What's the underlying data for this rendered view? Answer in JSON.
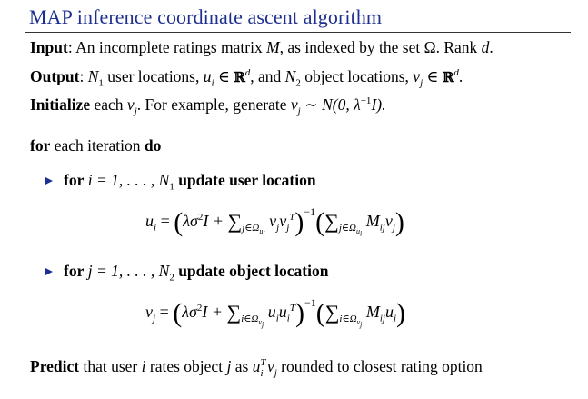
{
  "title": "MAP inference coordinate ascent algorithm",
  "input": {
    "label": "Input",
    "text_before": ": An incomplete ratings matrix ",
    "var_M": "M",
    "text_middle": ", as indexed by the set Ω. Rank ",
    "var_d": "d",
    "text_end": "."
  },
  "output": {
    "label": "Output",
    "text_1": ": ",
    "n1": "N",
    "n1_sub": "1",
    "text_2": " user locations, ",
    "u_expr": "u",
    "u_sub": "i",
    "in_R": " ∈ ",
    "R": "ℝ",
    "d_sup": "d",
    "text_3": ", and ",
    "n2": "N",
    "n2_sub": "2",
    "text_4": " object locations, ",
    "v_expr": "v",
    "v_sub": "j",
    "text_5": "."
  },
  "init": {
    "label": "Initialize",
    "text_1": " each ",
    "v": "v",
    "v_sub": "j",
    "text_2": ". For example, generate ",
    "dist": "v",
    "dist_sub": "j",
    "dist_rest": " ∼ N(0, λ",
    "lambda_sup": "−1",
    "dist_end": "I)."
  },
  "loop": {
    "for_label": "for",
    "text": " each iteration ",
    "do_label": "do"
  },
  "step1": {
    "for_label": "for",
    "range": " i = 1, . . . , N",
    "range_sub": "1",
    "action": " update user location"
  },
  "eq1": {
    "lhs": "u",
    "lhs_sub": "i",
    "eq": " = ",
    "lam": "λσ",
    "sq": "2",
    "plus": "I + ",
    "sum_sub": "j∈Ω",
    "sum_sub_sub": "u",
    "sum_sub_sub2": "i",
    "term": " v",
    "term_sub": "j",
    "term2": "v",
    "term2_sub": "j",
    "T": "T",
    "inv": "−1",
    "sum2_sub": "j∈Ω",
    "sum2_sub_sub": "u",
    "sum2_sub_sub2": "i",
    "term3": " M",
    "term3_sub": "ij",
    "term4": "v",
    "term4_sub": "j"
  },
  "step2": {
    "for_label": "for",
    "range": " j = 1, . . . , N",
    "range_sub": "2",
    "action": " update object location"
  },
  "eq2": {
    "lhs": "v",
    "lhs_sub": "j",
    "eq": " = ",
    "lam": "λσ",
    "sq": "2",
    "plus": "I + ",
    "sum_sub": "i∈Ω",
    "sum_sub_sub": "v",
    "sum_sub_sub2": "j",
    "term": " u",
    "term_sub": "i",
    "term2": "u",
    "term2_sub": "i",
    "T": "T",
    "inv": "−1",
    "sum2_sub": "i∈Ω",
    "sum2_sub_sub": "v",
    "sum2_sub_sub2": "j",
    "term3": " M",
    "term3_sub": "ij",
    "term4": "u",
    "term4_sub": "i"
  },
  "predict": {
    "label": "Predict",
    "text_1": " that user ",
    "i": "i",
    "text_2": " rates object ",
    "j": "j",
    "text_3": " as ",
    "u": "u",
    "u_sub": "i",
    "T": "T",
    "v": " v",
    "v_sub": "j",
    "text_4": " rounded to closest rating option"
  },
  "colors": {
    "title": "#1f2f8f",
    "bullet": "#1f2f8f",
    "text": "#000000"
  }
}
